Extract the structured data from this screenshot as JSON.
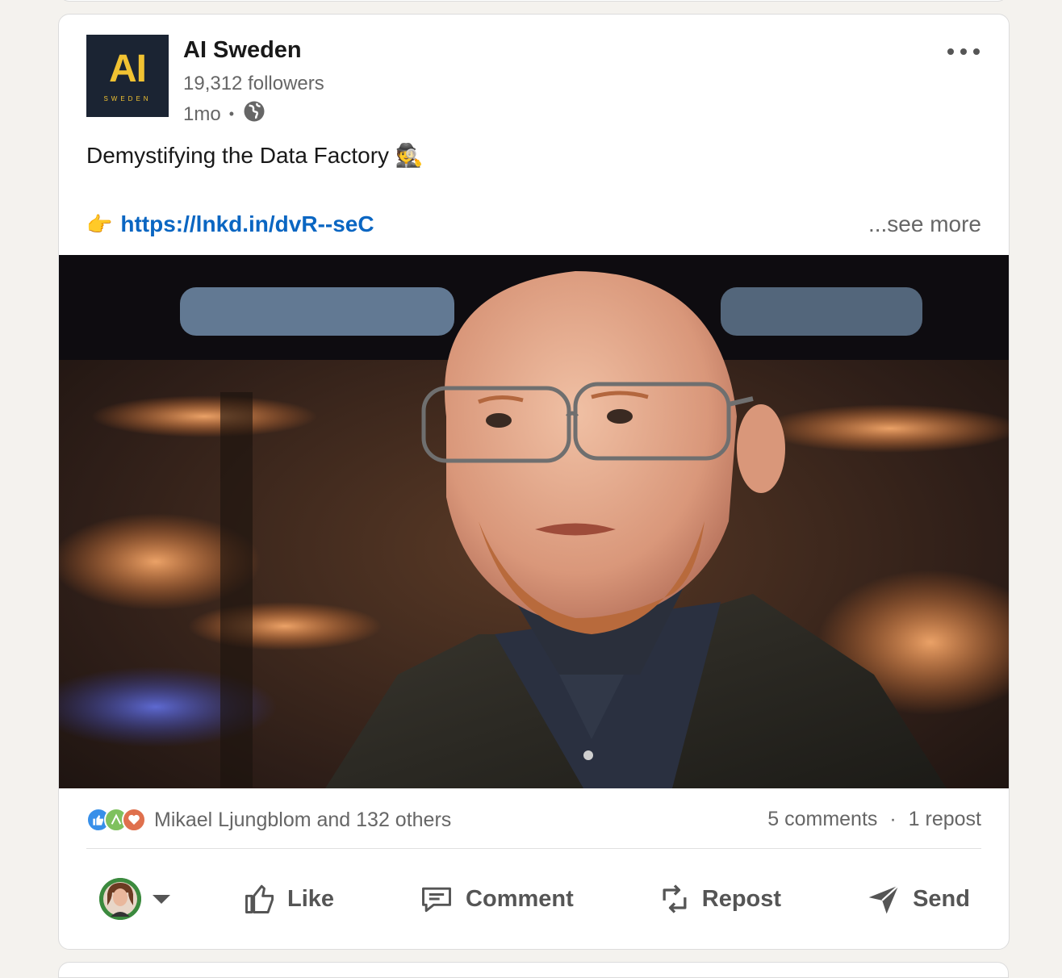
{
  "author": {
    "logo_text": "AI",
    "logo_subtext": "SWEDEN",
    "name": "AI Sweden",
    "followers": "19,312 followers",
    "time": "1mo",
    "visibility_icon": "globe-icon"
  },
  "post": {
    "text": "Demystifying the Data Factory 🕵️",
    "link_emoji": "👉",
    "link": "https://lnkd.in/dvR--seC",
    "see_more": "...see more"
  },
  "social": {
    "reaction_icons": [
      "like-icon",
      "support-icon",
      "love-icon"
    ],
    "reactions_text": "Mikael Ljungblom and 132 others",
    "comments": "5 comments",
    "separator": "·",
    "reposts": "1 repost"
  },
  "actions": {
    "like": "Like",
    "comment": "Comment",
    "repost": "Repost",
    "send": "Send"
  },
  "colors": {
    "link": "#0a66c2",
    "logo_bg": "#1b2433",
    "logo_fg": "#f1c232",
    "page_bg": "#f4f2ee"
  }
}
